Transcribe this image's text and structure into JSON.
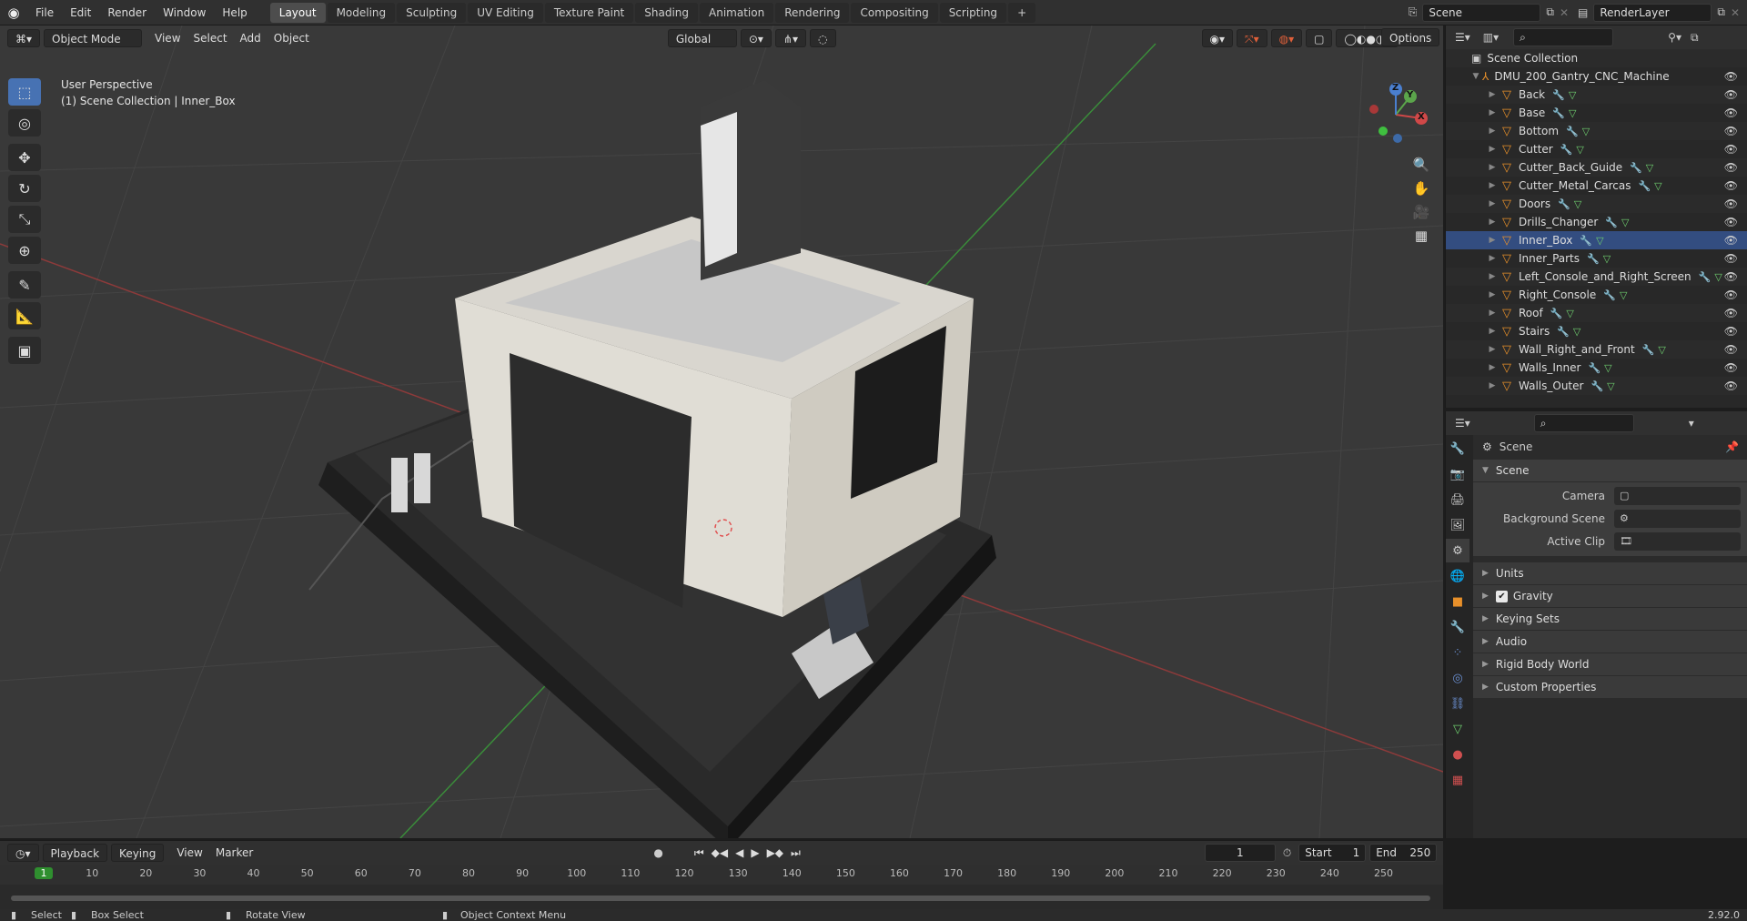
{
  "topbar": {
    "menus": [
      "File",
      "Edit",
      "Render",
      "Window",
      "Help"
    ],
    "workspaces": [
      "Layout",
      "Modeling",
      "Sculpting",
      "UV Editing",
      "Texture Paint",
      "Shading",
      "Animation",
      "Rendering",
      "Compositing",
      "Scripting"
    ],
    "active_workspace": "Layout",
    "scene_name": "Scene",
    "view_layer": "RenderLayer"
  },
  "viewport": {
    "mode": "Object Mode",
    "menus": [
      "View",
      "Select",
      "Add",
      "Object"
    ],
    "transform_orientation": "Global",
    "options_label": "Options",
    "overlay_line1": "User Perspective",
    "overlay_line2": "(1) Scene Collection | Inner_Box",
    "gizmo_axes": {
      "x": "X",
      "y": "Y",
      "z": "Z"
    }
  },
  "outliner": {
    "root": "Scene Collection",
    "collection": "DMU_200_Gantry_CNC_Machine",
    "items": [
      "Back",
      "Base",
      "Bottom",
      "Cutter",
      "Cutter_Back_Guide",
      "Cutter_Metal_Carcas",
      "Doors",
      "Drills_Changer",
      "Inner_Box",
      "Inner_Parts",
      "Left_Console_and_Right_Screen",
      "Right_Console",
      "Roof",
      "Stairs",
      "Wall_Right_and_Front",
      "Walls_Inner",
      "Walls_Outer"
    ],
    "selected": "Inner_Box"
  },
  "properties": {
    "context": "Scene",
    "panel": "Scene",
    "camera_label": "Camera",
    "background_scene_label": "Background Scene",
    "active_clip_label": "Active Clip",
    "sections": [
      "Units",
      "Gravity",
      "Keying Sets",
      "Audio",
      "Rigid Body World",
      "Custom Properties"
    ],
    "gravity_checked": true
  },
  "timeline": {
    "menus": [
      "Playback",
      "Keying",
      "View",
      "Marker"
    ],
    "current_frame": "1",
    "start_label": "Start",
    "start": "1",
    "end_label": "End",
    "end": "250",
    "ruler": [
      "1",
      "10",
      "20",
      "30",
      "40",
      "50",
      "60",
      "70",
      "80",
      "90",
      "100",
      "110",
      "120",
      "130",
      "140",
      "150",
      "160",
      "170",
      "180",
      "190",
      "200",
      "210",
      "220",
      "230",
      "240",
      "250"
    ]
  },
  "statusbar": {
    "select": "Select",
    "box_select": "Box Select",
    "rotate_view": "Rotate View",
    "context_menu": "Object Context Menu",
    "version": "2.92.0"
  },
  "colors": {
    "accent": "#4772b3",
    "object_icon": "#e8902a",
    "timeline_current": "#2f8f2f"
  }
}
